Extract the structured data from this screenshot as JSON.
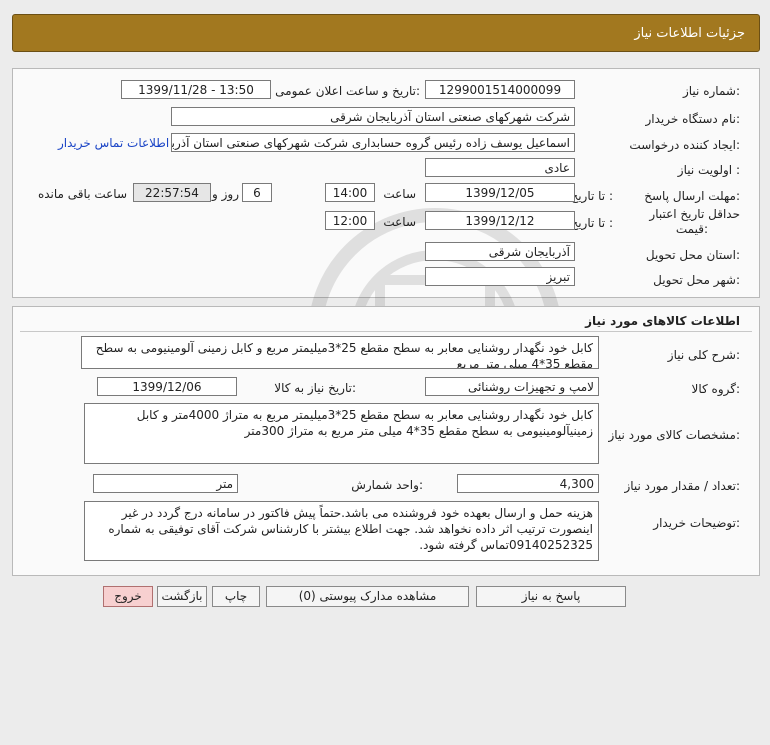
{
  "header": {
    "title": "جزئیات اطلاعات نیاز"
  },
  "general": {
    "need_number_label": "شماره نیاز:",
    "need_number": "1299001514000099",
    "announce_label": "تاریخ و ساعت اعلان عمومی:",
    "announce_value": "1399/11/28 - 13:50",
    "buyer_org_label": "نام دستگاه خریدار:",
    "buyer_org": "شرکت شهرکهای صنعتی استان آذربایجان شرقی",
    "requester_label": "ایجاد کننده درخواست:",
    "requester": "اسماعیل یوسف زاده رئیس گروه حسابداری شرکت شهرکهای صنعتی استان آذربایجان شرقی",
    "contact_link": "اطلاعات تماس خریدار",
    "priority_label": "اولویت نیاز :",
    "priority": "عادی",
    "deadline_label": "مهلت ارسال پاسخ:",
    "to_date_label": "تا تاریخ :",
    "deadline_date": "1399/12/05",
    "time_label": "ساعت",
    "deadline_time": "14:00",
    "days_value": "6",
    "days_label": "روز و",
    "remaining_time": "22:57:54",
    "remaining_label": "ساعت باقی مانده",
    "validity_label_1": "حداقل تاریخ اعتبار",
    "validity_label_2": "قیمت:",
    "validity_to_label": "تا تاریخ :",
    "validity_date": "1399/12/12",
    "validity_time_label": "ساعت",
    "validity_time": "12:00",
    "province_label": "استان محل تحویل:",
    "province": "آذربایجان شرقی",
    "city_label": "شهر محل تحویل:",
    "city": "تبریز"
  },
  "goods": {
    "section_title": "اطلاعات کالاهای مورد نیاز",
    "summary_label": "شرح کلی نیاز:",
    "summary": "کابل خود نگهدار روشنایی معابر به سطح مقطع 25*3میلیمتر مربع و کابل زمینی آلومینیومی به سطح مقطع 35*4 میلی متر مربع",
    "group_label": "گروه کالا:",
    "group": "لامپ و تجهیزات روشنائی",
    "need_date_label": "تاریخ نیاز به کالا:",
    "need_date": "1399/12/06",
    "specs_label": "مشخصات کالای مورد نیاز:",
    "specs": "کابل خود نگهدار روشنایی معابر به سطح مقطع 25*3میلیمتر مربع  به متراژ 4000متر و کابل زمینیآلومینیومی به سطح مقطع 35*4 میلی متر مربع به متراژ 300متر",
    "qty_label": "تعداد / مقدار مورد نیاز:",
    "qty": "4,300",
    "unit_label": "واحد شمارش:",
    "unit": "متر",
    "notes_label": "توضیحات خریدار:",
    "notes": "هزینه حمل و ارسال بعهده خود فروشنده می باشد.حتماً پیش فاکتور در سامانه درج گردد در غیر اینصورت ترتیب اثر داده نخواهد شد. جهت اطلاع بیشتر با کارشناس شرکت آقای توفیقی به شماره 09140252325تماس گرفته شود."
  },
  "buttons": {
    "reply": "پاسخ به نیاز",
    "attachments": "مشاهده مدارک پیوستی (0)",
    "print": "چاپ",
    "back": "بازگشت",
    "exit": "خروج"
  }
}
